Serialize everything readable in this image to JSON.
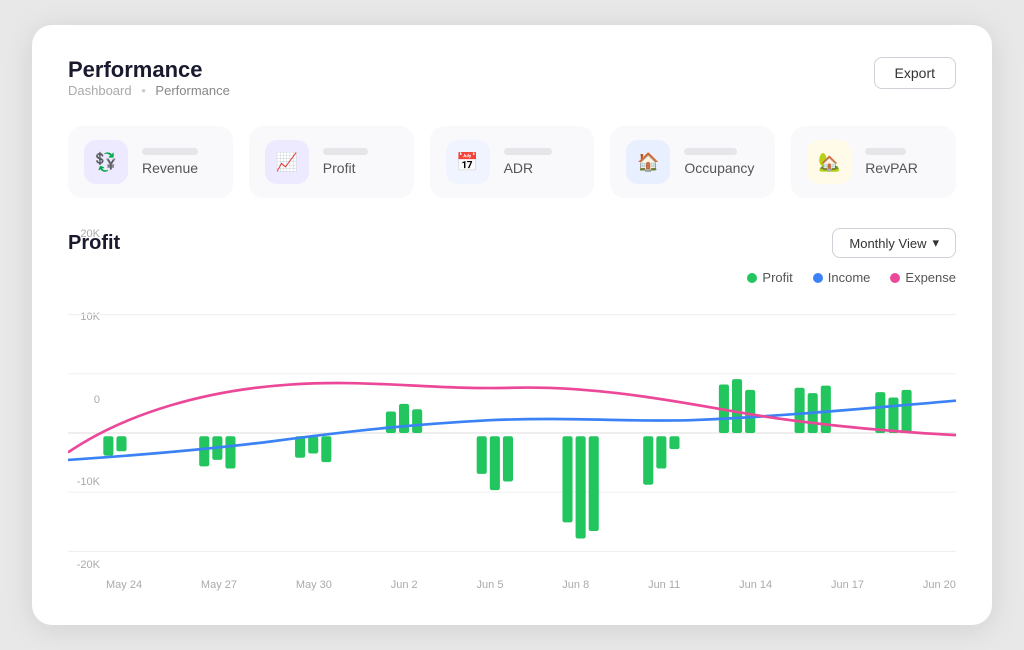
{
  "header": {
    "title": "Performance",
    "export_label": "Export"
  },
  "breadcrumb": {
    "parent": "Dashboard",
    "sep": "•",
    "current": "Performance"
  },
  "metrics": [
    {
      "id": "revenue",
      "label": "Revenue",
      "icon_color": "#ede9ff",
      "icon_symbol": "💱",
      "bar_width": "75%"
    },
    {
      "id": "profit",
      "label": "Profit",
      "icon_color": "#ede9ff",
      "icon_symbol": "📈",
      "bar_width": "60%"
    },
    {
      "id": "adr",
      "label": "ADR",
      "icon_color": "#f0f4ff",
      "icon_symbol": "📅",
      "bar_width": "65%"
    },
    {
      "id": "occupancy",
      "label": "Occupancy",
      "icon_color": "#e8f0ff",
      "icon_symbol": "🏠",
      "bar_width": "70%"
    },
    {
      "id": "revpar",
      "label": "RevPAR",
      "icon_color": "#fffbe8",
      "icon_symbol": "🏡",
      "bar_width": "55%"
    }
  ],
  "chart": {
    "title": "Profit",
    "view_label": "Monthly View",
    "chevron": "▾",
    "legend": [
      {
        "label": "Profit",
        "color": "#22c55e"
      },
      {
        "label": "Income",
        "color": "#3b82f6"
      },
      {
        "label": "Expense",
        "color": "#ec4899"
      }
    ],
    "y_labels": [
      "20K",
      "10K",
      "0",
      "-10K",
      "-20K"
    ],
    "x_labels": [
      "May 24",
      "May 27",
      "May 30",
      "Jun 2",
      "Jun 5",
      "Jun 8",
      "Jun 11",
      "Jun 14",
      "Jun 17",
      "Jun 20"
    ]
  }
}
